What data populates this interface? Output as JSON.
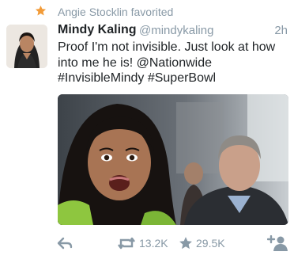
{
  "context": {
    "text": "Angie Stocklin favorited",
    "icon": "star-icon",
    "icon_color": "#f29b38"
  },
  "tweet": {
    "display_name": "Mindy Kaling",
    "handle": "@mindykaling",
    "timestamp": "2h",
    "text_lines": [
      "Proof I'm not invisible. Just look at how",
      "into me he is! @Nationwide",
      "#InvisibleMindy #SuperBowl"
    ]
  },
  "actions": {
    "reply_icon": "reply-icon",
    "retweet_icon": "retweet-icon",
    "retweet_count": "13.2K",
    "favorite_icon": "star-icon",
    "favorite_count": "29.5K",
    "follow_icon": "add-user-icon"
  },
  "colors": {
    "text": "#1f2326",
    "muted": "#8899a6",
    "accent_star": "#f29b38"
  }
}
